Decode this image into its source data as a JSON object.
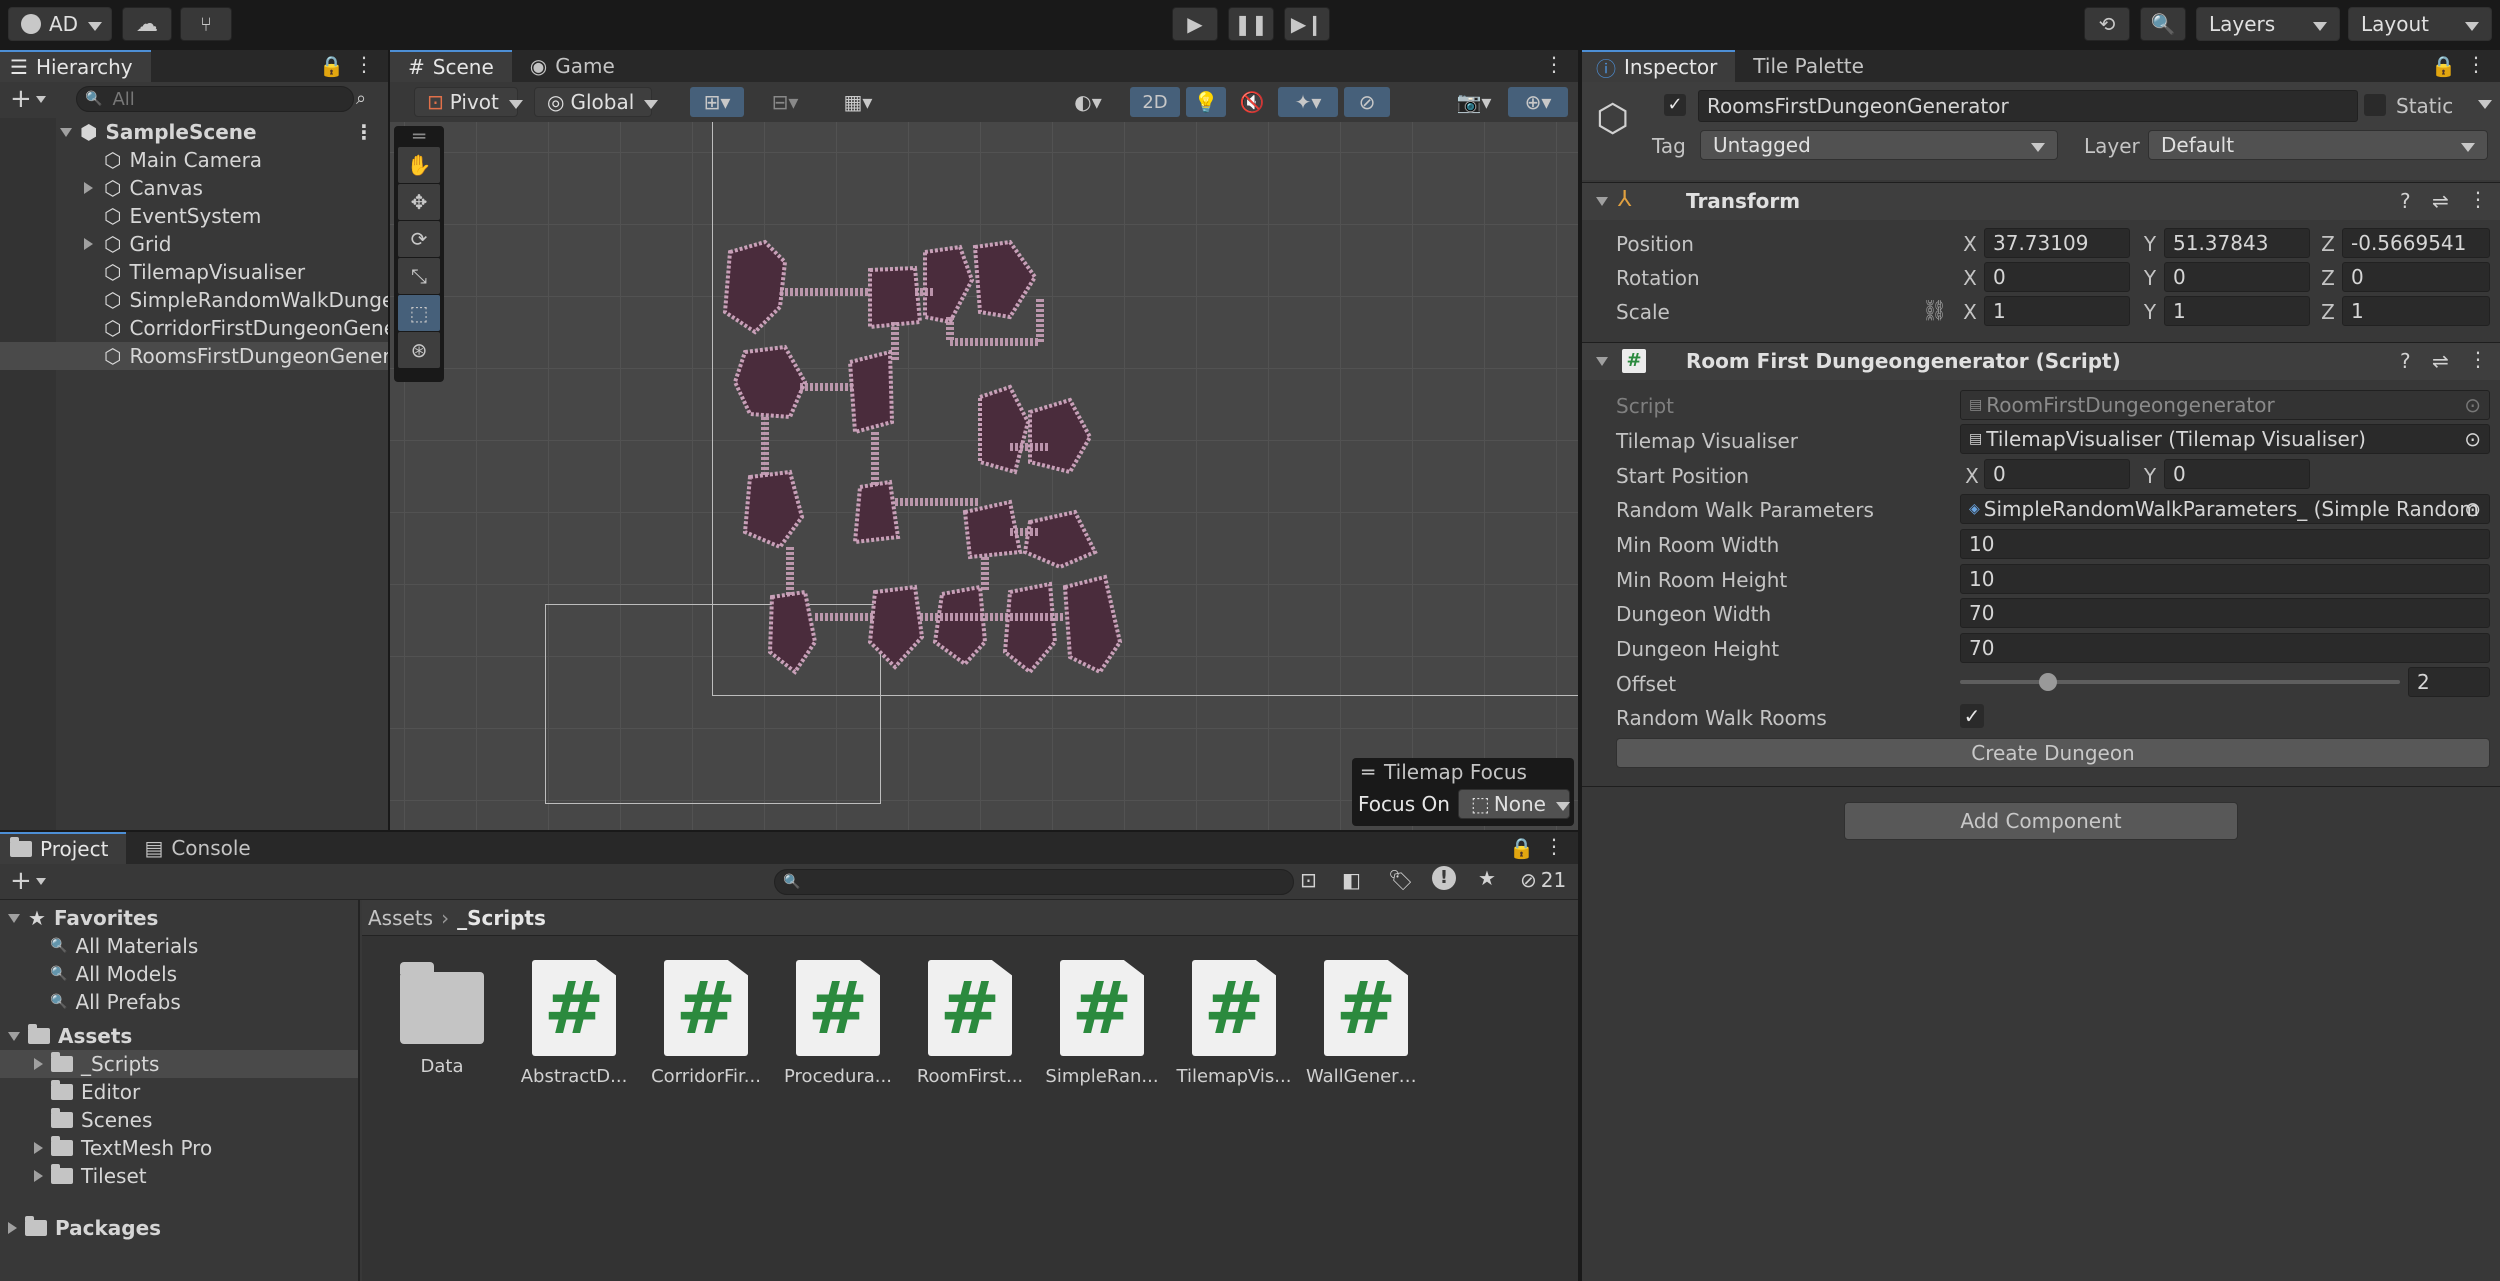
{
  "toolbar": {
    "account": "AD",
    "layers": "Layers",
    "layout": "Layout"
  },
  "hierarchy": {
    "tab": "Hierarchy",
    "search_placeholder": "All",
    "scene": "SampleScene",
    "items": [
      {
        "label": "Main Camera",
        "expandable": false
      },
      {
        "label": "Canvas",
        "expandable": true
      },
      {
        "label": "EventSystem",
        "expandable": false
      },
      {
        "label": "Grid",
        "expandable": true
      },
      {
        "label": "TilemapVisualiser",
        "expandable": false
      },
      {
        "label": "SimpleRandomWalkDungeonGenerator",
        "expandable": false
      },
      {
        "label": "CorridorFirstDungeonGenerator",
        "expandable": false
      },
      {
        "label": "RoomsFirstDungeonGenerator",
        "expandable": false,
        "selected": true
      }
    ]
  },
  "scene": {
    "tabs": [
      "Scene",
      "Game"
    ],
    "pivot": "Pivot",
    "global": "Global",
    "mode_2d": "2D",
    "tilemap_focus": {
      "title": "Tilemap Focus",
      "focus_label": "Focus On",
      "focus_value": "None"
    }
  },
  "inspector": {
    "tabs": [
      "Inspector",
      "Tile Palette"
    ],
    "object_name": "RoomsFirstDungeonGenerator",
    "static_label": "Static",
    "tag_label": "Tag",
    "tag_value": "Untagged",
    "layer_label": "Layer",
    "layer_value": "Default",
    "transform": {
      "title": "Transform",
      "position_label": "Position",
      "rotation_label": "Rotation",
      "scale_label": "Scale",
      "position": {
        "x": "37.73109",
        "y": "51.37843",
        "z": "-0.5669541"
      },
      "rotation": {
        "x": "0",
        "y": "0",
        "z": "0"
      },
      "scale": {
        "x": "1",
        "y": "1",
        "z": "1"
      }
    },
    "component": {
      "title": "Room First Dungeongenerator (Script)",
      "script_label": "Script",
      "script_value": "RoomFirstDungeongenerator",
      "tilemap_label": "Tilemap Visualiser",
      "tilemap_value": "TilemapVisualiser (Tilemap Visualiser)",
      "start_label": "Start Position",
      "start": {
        "x": "0",
        "y": "0"
      },
      "rwp_label": "Random Walk Parameters",
      "rwp_value": "SimpleRandomWalkParameters_ (Simple Random",
      "min_w_label": "Min Room Width",
      "min_w": "10",
      "min_h_label": "Min Room Height",
      "min_h": "10",
      "dw_label": "Dungeon Width",
      "dw": "70",
      "dh_label": "Dungeon Height",
      "dh": "70",
      "offset_label": "Offset",
      "offset": "2",
      "offset_fraction": 0.2,
      "rwr_label": "Random Walk Rooms",
      "rwr_checked": true,
      "create_button": "Create Dungeon"
    },
    "add_component": "Add Component"
  },
  "project": {
    "tabs": [
      "Project",
      "Console"
    ],
    "hidden_count": "21",
    "breadcrumb_root": "Assets",
    "breadcrumb_current": "_Scripts",
    "favorites_label": "Favorites",
    "favorites": [
      "All Materials",
      "All Models",
      "All Prefabs"
    ],
    "assets_label": "Assets",
    "asset_folders": [
      "_Scripts",
      "Editor",
      "Scenes",
      "TextMesh Pro",
      "Tileset"
    ],
    "packages_label": "Packages",
    "files": [
      {
        "name": "Data",
        "kind": "folder"
      },
      {
        "name": "AbstractD...",
        "kind": "script"
      },
      {
        "name": "CorridorFir...",
        "kind": "script"
      },
      {
        "name": "Procedura...",
        "kind": "script"
      },
      {
        "name": "RoomFirst...",
        "kind": "script"
      },
      {
        "name": "SimpleRan...",
        "kind": "script"
      },
      {
        "name": "TilemapVis...",
        "kind": "script"
      },
      {
        "name": "WallGenera...",
        "kind": "script"
      }
    ]
  },
  "colors": {
    "accent": "#4d8fd6",
    "room_fill": "#4a2c3c",
    "room_wall": "#c8a0b8",
    "script_hash": "#2b8a3e"
  }
}
